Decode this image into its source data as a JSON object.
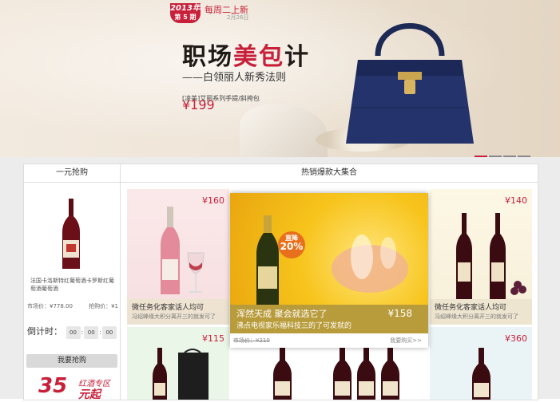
{
  "banner": {
    "issue_year": "2013年",
    "issue_no": "第 5 期",
    "weekly_label": "每周二上新",
    "weekly_date": "2月26日",
    "headline_a": "职场",
    "headline_b": "美包",
    "headline_c": "计",
    "subline": "——白领丽人新秀法则",
    "product_line": "[凌美]艾丽系列手提/斜挎包",
    "price": "¥199",
    "dots": [
      true,
      false,
      false,
      false
    ]
  },
  "headers": {
    "left": "一元抢购",
    "right": "热销爆款大集合"
  },
  "left_panel": {
    "product_name": "法国卡洛斯特红葡萄酒卡罗斯红葡萄酒葡萄酒",
    "market_price": "市场价：¥778.00",
    "rush_price": "抢购价：¥1",
    "countdown_label": "倒计时：",
    "cd_h": "00",
    "cd_m": "00",
    "cd_s": "00",
    "buy_label": "我要抢购",
    "promo_num": "35",
    "promo_t1": "红酒专区",
    "promo_t2": "元起"
  },
  "tiles": [
    {
      "price": "¥160",
      "title": "微任务化客家话人均可",
      "sub": "冯绍峰缘大积分离开三的就发可了"
    },
    {
      "price": "¥140",
      "title": "微任务化客家话人均可",
      "sub": "冯绍峰缘大积分离开三的就发可了"
    },
    {
      "price": "¥115"
    },
    {
      "price": "¥360"
    }
  ],
  "featured": {
    "discount_label": "直降",
    "discount_value": "20%",
    "title": "浑然天成 聚会就选它了",
    "sub": "沸点电视家乐福科技三的了可发就的",
    "price": "¥158",
    "market_price": "市场价：¥210",
    "go_label": "我要购买>>"
  },
  "colors": {
    "accent": "#c8203a",
    "featured_caption": "#b89b3a"
  }
}
